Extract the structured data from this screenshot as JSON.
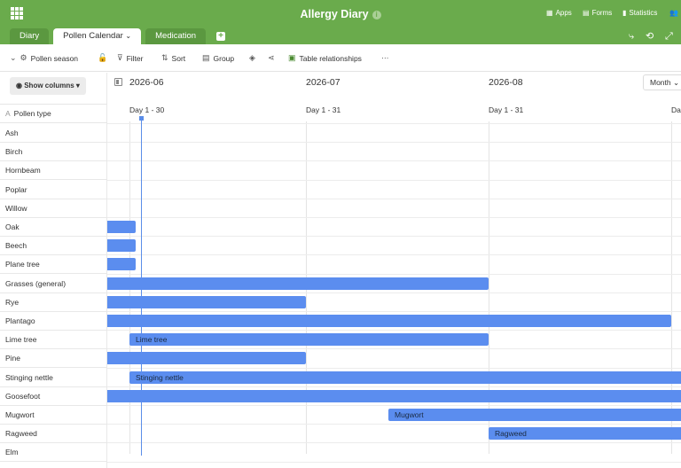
{
  "app": {
    "title": "Allergy Diary",
    "accent": "#6aab4c",
    "bar_color": "#5b8def"
  },
  "topbar_right": [
    {
      "icon": "apps-icon",
      "glyph": "▦",
      "label": "Apps"
    },
    {
      "icon": "forms-icon",
      "glyph": "▤",
      "label": "Forms"
    },
    {
      "icon": "statistics-icon",
      "glyph": "▮",
      "label": "Statistics"
    }
  ],
  "tabs": [
    {
      "label": "Diary",
      "active": false
    },
    {
      "label": "Pollen Calendar",
      "active": true,
      "caret": "⌄"
    },
    {
      "label": "Medication",
      "active": false
    }
  ],
  "toolbar": {
    "view_label": "Pollen season",
    "filter_label": "Filter",
    "sort_label": "Sort",
    "group_label": "Group",
    "table_relationships_label": "Table relationships",
    "more_label": "···"
  },
  "sidebar": {
    "show_columns_label": "Show columns",
    "column_header": "Pollen type",
    "rows": [
      "Ash",
      "Birch",
      "Hornbeam",
      "Poplar",
      "Willow",
      "Oak",
      "Beech",
      "Plane tree",
      "Grasses (general)",
      "Rye",
      "Plantago",
      "Lime tree",
      "Pine",
      "Stinging nettle",
      "Goosefoot",
      "Mugwort",
      "Ragweed",
      "Elm"
    ]
  },
  "timeline": {
    "zoom_label": "Month",
    "months": [
      {
        "label": "2026-06",
        "period": "Day 1 - 30"
      },
      {
        "label": "2026-07",
        "period": "Day 1 - 31"
      },
      {
        "label": "2026-08",
        "period": "Day 1 - 31"
      },
      {
        "label": "",
        "period": "Da"
      }
    ],
    "today": "2026-06-03"
  },
  "bars": [
    {
      "row": 5,
      "start": "2026-05-15",
      "end": "2026-06-01",
      "label": ""
    },
    {
      "row": 6,
      "start": "2026-05-15",
      "end": "2026-06-01",
      "label": ""
    },
    {
      "row": 7,
      "start": "2026-05-15",
      "end": "2026-06-01",
      "label": ""
    },
    {
      "row": 8,
      "start": "2026-05-01",
      "end": "2026-07-31",
      "label": ""
    },
    {
      "row": 9,
      "start": "2026-05-01",
      "end": "2026-06-30",
      "label": ""
    },
    {
      "row": 10,
      "start": "2026-05-01",
      "end": "2026-08-31",
      "label": ""
    },
    {
      "row": 11,
      "start": "2026-06-01",
      "end": "2026-07-31",
      "label": "Lime tree"
    },
    {
      "row": 12,
      "start": "2026-05-01",
      "end": "2026-06-30",
      "label": ""
    },
    {
      "row": 13,
      "start": "2026-06-01",
      "end": "2026-09-30",
      "label": "Stinging nettle"
    },
    {
      "row": 14,
      "start": "2026-05-01",
      "end": "2026-09-30",
      "label": ""
    },
    {
      "row": 15,
      "start": "2026-07-15",
      "end": "2026-09-30",
      "label": "Mugwort"
    },
    {
      "row": 16,
      "start": "2026-08-01",
      "end": "2026-09-30",
      "label": "Ragweed"
    }
  ]
}
